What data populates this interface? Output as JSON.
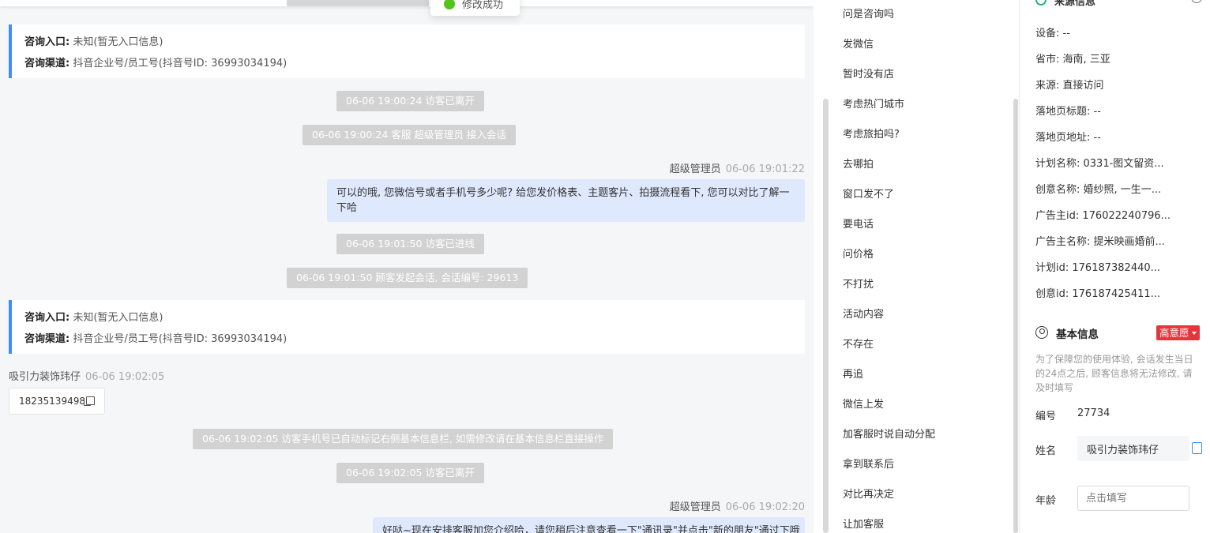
{
  "toast": {
    "text": "修改成功"
  },
  "chat": {
    "info_cards": [
      {
        "entry_label": "咨询入口:",
        "entry_value": "未知(暂无入口信息)",
        "channel_label": "咨询渠道:",
        "channel_value": "抖音企业号/员工号(抖音号ID:  36993034194)"
      },
      {
        "entry_label": "咨询入口:",
        "entry_value": "未知(暂无入口信息)",
        "channel_label": "咨询渠道:",
        "channel_value": "抖音企业号/员工号(抖音号ID:  36993034194)"
      }
    ],
    "system_messages": [
      "06-06 19:00:24 访客已离开",
      "06-06 19:00:24 客服 超级管理员 接入会话",
      "06-06 19:01:50 访客已进线",
      "06-06 19:01:50 顾客发起会话, 会话编号: 29613",
      "06-06 19:02:05 访客手机号已自动标记右侧基本信息栏, 如需修改请在基本信息栏直接操作",
      "06-06 19:02:05 访客已离开"
    ],
    "agent_messages": [
      {
        "sender": "超级管理员",
        "time": "06-06 19:01:22",
        "text": "可以的哦, 您微信号或者手机号多少呢? 给您发价格表、主题客片、拍摄流程看下, 您可以对比了解一下哈"
      },
      {
        "sender": "超级管理员",
        "time": "06-06 19:02:20",
        "text": "好哒~现在安排客服加您介绍哈，请您稍后注意查看一下\"通讯录\"并点击\"新的朋友\"通过下哦"
      }
    ],
    "visitor_message": {
      "sender": "吸引力装饰玮仔",
      "time": "06-06 19:02:05",
      "text": "18235139498"
    }
  },
  "quick_replies": [
    "问是咨询吗",
    "发微信",
    "暂时没有店",
    "考虑热门城市",
    "考虑旅拍吗?",
    "去哪拍",
    "窗口发不了",
    "要电话",
    "问价格",
    "不打扰",
    "活动内容",
    "不存在",
    "再追",
    "微信上发",
    "加客服时说自动分配",
    "拿到联系后",
    "对比再决定",
    "让加客服"
  ],
  "source_info": {
    "title": "来源信息",
    "items": [
      "设备: --",
      "省市: 海南, 三亚",
      "来源: 直接访问",
      "落地页标题: --",
      "落地页地址: --",
      "计划名称: 0331-图文留资...",
      "创意名称: 婚纱照, 一生一...",
      "广告主id: 176022240796...",
      "广告主名称: 提米映画婚前...",
      "计划id: 176187382440...",
      "创意id: 176187425411..."
    ]
  },
  "basic_info": {
    "title": "基本信息",
    "intent": "高意愿",
    "note": "为了保障您的使用体验, 会话发生当日的24点之后, 顾客信息将无法修改, 请及时填写",
    "id_label": "编号",
    "id_value": "27734",
    "name_label": "姓名",
    "name_value": "吸引力装饰玮仔",
    "age_label": "年龄",
    "age_placeholder": "点击填写"
  },
  "colors": {
    "accent": "#3f8cff",
    "intent_red": "#e8343d",
    "success_green": "#52c41a",
    "agent_bubble": "#dfe9fd"
  }
}
